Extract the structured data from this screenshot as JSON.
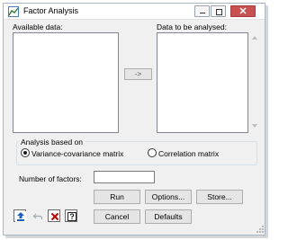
{
  "window": {
    "title": "Factor Analysis"
  },
  "available": {
    "label": "Available data:"
  },
  "analysed": {
    "label": "Data to be analysed:"
  },
  "add_button": {
    "label": "->"
  },
  "analysis_group": {
    "legend": "Analysis based on",
    "options": [
      "Variance-covariance matrix",
      "Correlation matrix"
    ],
    "selected": "Variance-covariance matrix"
  },
  "factors": {
    "label": "Number of factors:",
    "value": ""
  },
  "buttons": {
    "run": "Run",
    "options": "Options...",
    "store": "Store...",
    "cancel": "Cancel",
    "defaults": "Defaults"
  },
  "icons": {
    "app": "factor-analysis-icon",
    "toolbar": [
      "send-to-script-icon",
      "undo-icon",
      "clear-icon",
      "help-icon"
    ]
  },
  "colors": {
    "clear_x": "#c00000",
    "close_button": "#c75050",
    "send_icon": "#1e5fb4"
  }
}
